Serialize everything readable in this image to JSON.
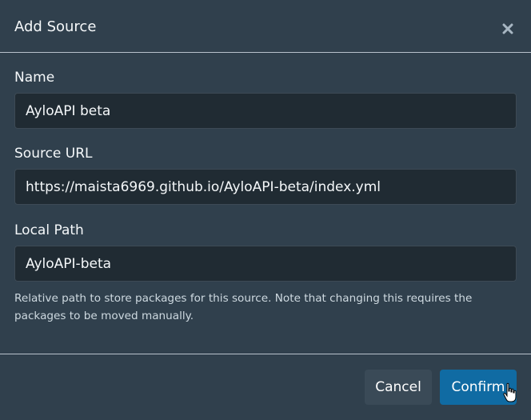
{
  "dialog": {
    "title": "Add Source",
    "close_icon": "close-icon"
  },
  "fields": {
    "name": {
      "label": "Name",
      "value": "AyloAPI beta"
    },
    "source_url": {
      "label": "Source URL",
      "value": "https://maista6969.github.io/AyloAPI-beta/index.yml"
    },
    "local_path": {
      "label": "Local Path",
      "value": "AyloAPI-beta"
    },
    "local_path_help": "Relative path to store packages for this source. Note that changing this requires the packages to be moved manually."
  },
  "footer": {
    "cancel_label": "Cancel",
    "confirm_label": "Confirm",
    "cursor_icon": "hand-pointer-icon"
  },
  "colors": {
    "background": "#30404d",
    "input_background": "#202b33",
    "primary_button": "#106ba3",
    "secondary_button": "#3a4a57"
  }
}
